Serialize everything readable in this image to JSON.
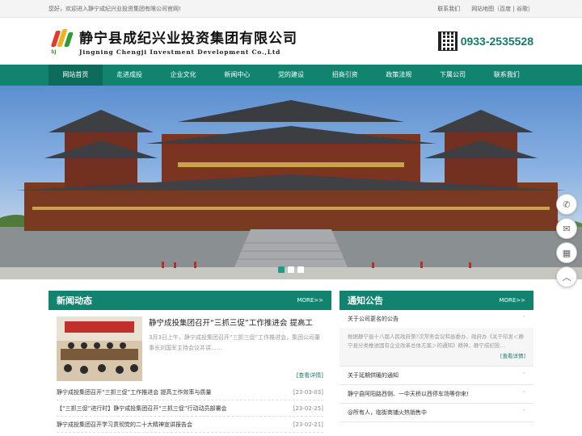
{
  "topbar": {
    "welcome": "您好，欢迎进入静宁成纪兴业投资集团有限公司官网!",
    "links": [
      "联系我们",
      "网站地图（百度 | 谷歌）"
    ]
  },
  "header": {
    "logo_sub": "SJ",
    "title_cn": "静宁县成纪兴业投资集团有限公司",
    "title_en": "Jingning Chengji Investment Development Co.,Ltd",
    "phone": "0933-2535528"
  },
  "nav": [
    "网站首页",
    "走进成投",
    "企业文化",
    "新闻中心",
    "党的建设",
    "招商引资",
    "政策法规",
    "下属公司",
    "联系我们"
  ],
  "banner": {
    "slides": 3,
    "active": 0
  },
  "float_buttons": [
    {
      "icon": "phone-icon",
      "glyph": "✆"
    },
    {
      "icon": "chat-icon",
      "glyph": "✉"
    },
    {
      "icon": "qrcode-icon",
      "glyph": "▦"
    },
    {
      "icon": "back-to-top-icon",
      "glyph": "︿"
    }
  ],
  "news": {
    "title": "新闻动态",
    "more": "MORE>>",
    "feature": {
      "title": "静宁成投集团召开“三抓三促”工作推进会 提高工",
      "desc": "3月3日上午，静宁成投集团召开“三抓三促”工作推进会，集团公司董事长刘国军主持会议并讲……",
      "detail": "[查看详情]"
    },
    "items": [
      {
        "title": "静宁成投集团召开“三抓三促”工作推进会 提高工作效率与质量",
        "date": "[23-03-03]"
      },
      {
        "title": "【“三抓三促”进行时】静宁成投集团召开“三抓三促”行动动员部署会",
        "date": "[23-02-25]"
      },
      {
        "title": "静宁成投集团召开学习贯彻党的二十大精神宣讲报告会",
        "date": "[23-02-21]"
      }
    ]
  },
  "notice": {
    "title": "通知公告",
    "more": "MORE>>",
    "items": [
      {
        "title": "关于公司更名的公告",
        "expanded": true,
        "body": "根据静宁县十八届人民政府第?次常务会议和县委办、政府办《关于印发＜静宁县分类推进国有企业改革总体方案＞的通知》精神，静宁成纪投…",
        "detail": "[查看详情]"
      },
      {
        "title": "关于延期供暖的通知",
        "expanded": false
      },
      {
        "title": "静宁县阿阳路西侧、一中天桥以西停车场等你来!",
        "expanded": false
      },
      {
        "title": "@所有人，临街商铺火热销售中",
        "expanded": false
      }
    ]
  }
}
